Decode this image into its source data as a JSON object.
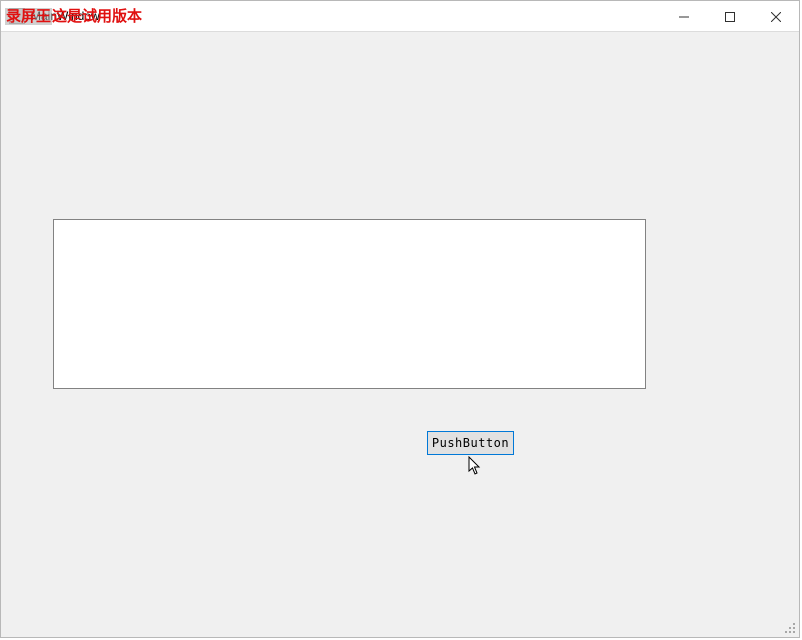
{
  "titlebar": {
    "trial_text_hl": "录屏王",
    "trial_text_rest": "这是试用版本",
    "original_title": "MainWindow"
  },
  "controls": {
    "minimize_name": "minimize",
    "maximize_name": "maximize",
    "close_name": "close"
  },
  "main": {
    "text_value": "",
    "push_button_label": "PushButton"
  }
}
